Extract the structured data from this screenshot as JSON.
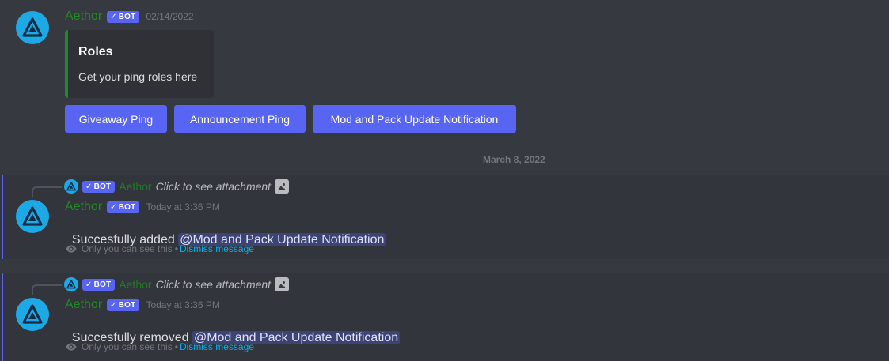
{
  "messages": [
    {
      "author": "Aethor",
      "bot_tag": "BOT",
      "check": "✓",
      "timestamp": "02/14/2022",
      "embed": {
        "title": "Roles",
        "description": "Get your ping roles here",
        "color": "#1f8b24"
      },
      "buttons": [
        {
          "label": "Giveaway Ping"
        },
        {
          "label": "Announcement Ping"
        },
        {
          "label": "Mod and Pack Update Notification"
        }
      ]
    }
  ],
  "date_divider": "March 8, 2022",
  "ephemeral": [
    {
      "reply_author": "Aethor",
      "reply_bot_tag": "BOT",
      "reply_check": "✓",
      "reply_text": "Click to see attachment",
      "author": "Aethor",
      "bot_tag": "BOT",
      "check": "✓",
      "timestamp": "Today at 3:36 PM",
      "text_prefix": "Succesfully added ",
      "mention": "@Mod and Pack Update Notification",
      "only_you": "Only you can see this",
      "bullet": "•",
      "dismiss": "Dismiss message"
    },
    {
      "reply_author": "Aethor",
      "reply_bot_tag": "BOT",
      "reply_check": "✓",
      "reply_text": "Click to see attachment",
      "author": "Aethor",
      "bot_tag": "BOT",
      "check": "✓",
      "timestamp": "Today at 3:36 PM",
      "text_prefix": "Succesfully removed ",
      "mention": "@Mod and Pack Update Notification",
      "only_you": "Only you can see this",
      "bullet": "•",
      "dismiss": "Dismiss message"
    }
  ],
  "colors": {
    "background": "#36393f",
    "blurple": "#5865f2",
    "bot_name": "#1f8b24",
    "avatar": "#1da9e6",
    "link": "#00aff4"
  },
  "icons": [
    "aethor-avatar-icon",
    "check-icon",
    "image-icon",
    "eye-icon"
  ]
}
